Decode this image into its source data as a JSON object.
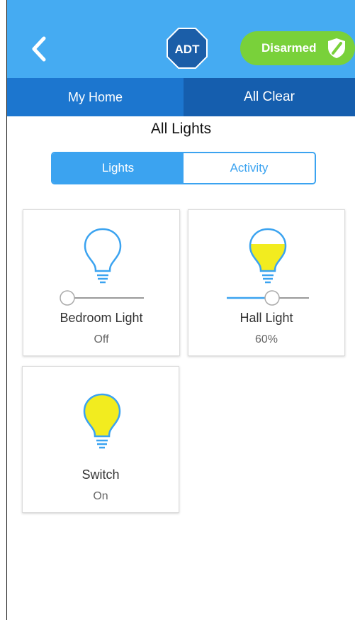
{
  "header": {
    "logo_text": "ADT",
    "status_pill_label": "Disarmed",
    "back_icon": "chevron-left-icon",
    "shield_icon": "shield-icon",
    "colors": {
      "header_bg": "#45abf2",
      "pill_bg": "#79d13a",
      "logo_bg": "#1b5ea8"
    }
  },
  "status_bar": {
    "location": "My Home",
    "system_status": "All Clear"
  },
  "page": {
    "title": "All Lights"
  },
  "tabs": [
    {
      "label": "Lights",
      "active": true
    },
    {
      "label": "Activity",
      "active": false
    }
  ],
  "devices": [
    {
      "name": "Bedroom Light",
      "value": "Off",
      "icon": "lightbulb-icon",
      "level": 0,
      "has_slider": true
    },
    {
      "name": "Hall Light",
      "value": "60%",
      "icon": "lightbulb-icon",
      "level": 0.6,
      "has_slider": true
    },
    {
      "name": "Switch",
      "value": "On",
      "icon": "lightbulb-icon",
      "level": 1,
      "has_slider": false
    }
  ]
}
